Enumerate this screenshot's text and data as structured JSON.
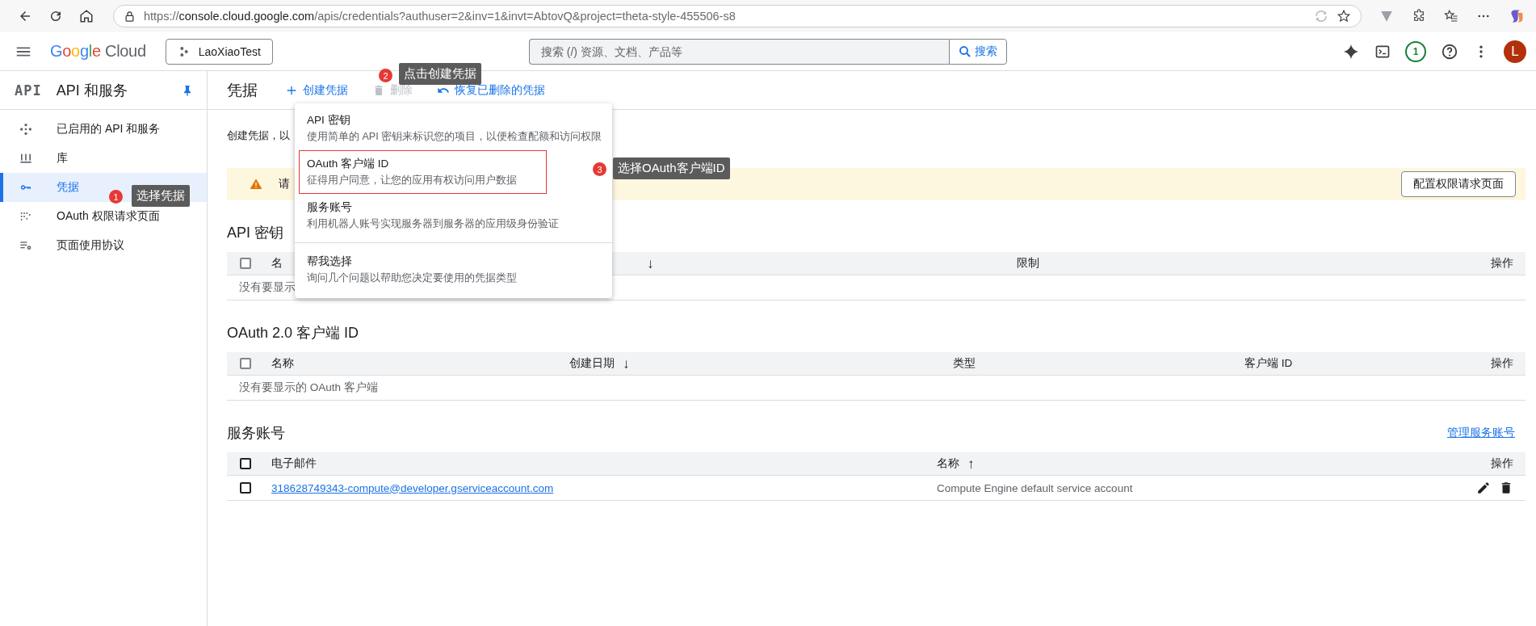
{
  "browser": {
    "url": {
      "scheme": "https://",
      "host": "console.cloud.google.com",
      "path": "/apis/credentials?authuser=2&inv=1&invt=AbtovQ&project=theta-style-455506-s8"
    }
  },
  "header": {
    "logo": {
      "word": "Google",
      "product": "Cloud"
    },
    "project": "LaoXiaoTest",
    "search": {
      "placeholder": "搜索 (/) 资源、文档、产品等",
      "button": "搜索"
    },
    "notifications": "1",
    "avatar": "L"
  },
  "sidebar": {
    "badge": "API",
    "title": "API 和服务",
    "items": [
      {
        "label": "已启用的 API 和服务",
        "kind": "enabled",
        "selected": false
      },
      {
        "label": "库",
        "kind": "library",
        "selected": false
      },
      {
        "label": "凭据",
        "kind": "credentials",
        "selected": true
      },
      {
        "label": "OAuth 权限请求页面",
        "kind": "consent",
        "selected": false
      },
      {
        "label": "页面使用协议",
        "kind": "agreements",
        "selected": false
      }
    ]
  },
  "toolbar": {
    "title": "凭据",
    "actions": [
      {
        "label": "创建凭据",
        "kind": "add",
        "disabled": false
      },
      {
        "label": "删除",
        "kind": "delete",
        "disabled": true
      },
      {
        "label": "恢复已删除的凭据",
        "kind": "restore",
        "disabled": false
      }
    ]
  },
  "intro": "创建凭据，以",
  "banner": {
    "text": "请",
    "button": "配置权限请求页面"
  },
  "sections": [
    {
      "title": "API 密钥",
      "columns": [
        {
          "label": "名"
        },
        {
          "sort_arrow": "↓"
        },
        {
          "label": "限制"
        },
        {
          "label": "操作"
        }
      ],
      "header_checkbox": {
        "checked": false,
        "disabled": true
      },
      "empty_text": "没有要显示"
    },
    {
      "title": "OAuth 2.0 客户端 ID",
      "columns": [
        {
          "label": "名称"
        },
        {
          "label": "创建日期",
          "sort_arrow": "↓"
        },
        {
          "label": "类型"
        },
        {
          "label": "客户端 ID"
        },
        {
          "label": "操作"
        }
      ],
      "header_checkbox": {
        "checked": false,
        "disabled": true
      },
      "empty_text": "没有要显示的 OAuth 客户端"
    },
    {
      "title": "服务账号",
      "link": "管理服务账号",
      "columns": [
        {
          "label": "电子邮件"
        },
        {
          "label": "名称",
          "sort_arrow": "↑"
        },
        {
          "label": "操作"
        }
      ],
      "header_checkbox": {
        "checked": false,
        "disabled": false
      },
      "rows": [
        {
          "checked": false,
          "email": "318628749343-compute@developer.gserviceaccount.com",
          "name": "Compute Engine default service account",
          "can_edit": true,
          "can_delete": true
        }
      ]
    }
  ],
  "menu": {
    "items": [
      {
        "title": "API 密钥",
        "description": "使用简单的 API 密钥来标识您的项目，以便检查配额和访问权限",
        "divider_before": false,
        "annotated": false
      },
      {
        "title": "OAuth 客户端 ID",
        "description": "征得用户同意，让您的应用有权访问用户数据",
        "divider_before": false,
        "annotated": true
      },
      {
        "title": "服务账号",
        "description": "利用机器人账号实现服务器到服务器的应用级身份验证",
        "divider_before": false,
        "annotated": false
      },
      {
        "title": "帮我选择",
        "description": "询问几个问题以帮助您决定要使用的凭据类型",
        "divider_before": true,
        "annotated": false
      }
    ]
  },
  "annotations": [
    {
      "number": "1",
      "label": "选择凭据"
    },
    {
      "number": "2",
      "label": "点击创建凭据"
    },
    {
      "number": "3",
      "label": "选择OAuth客户端ID"
    }
  ]
}
